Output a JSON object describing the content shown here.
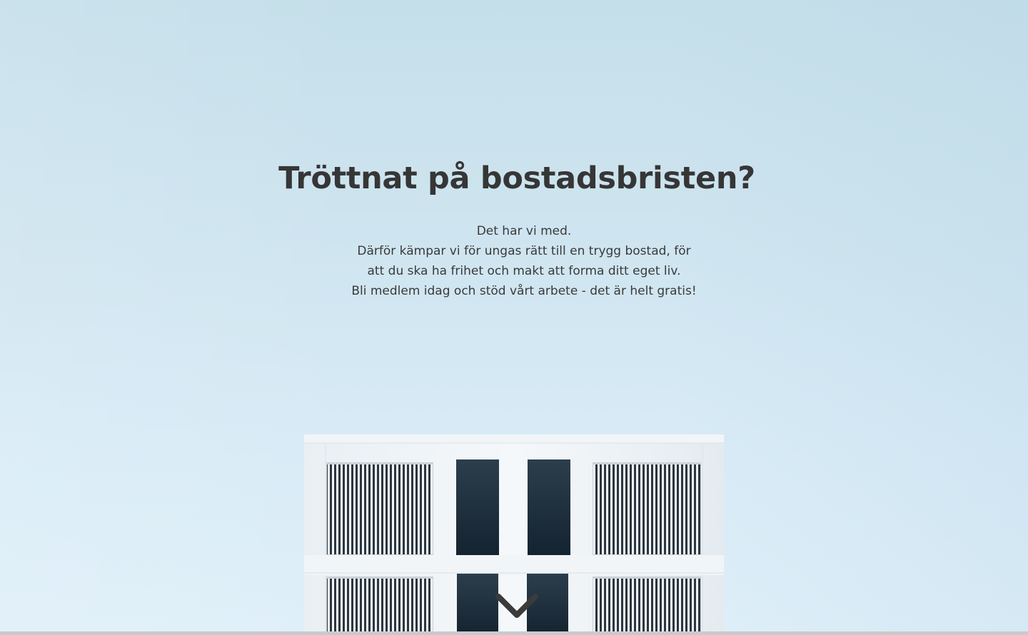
{
  "hero": {
    "headline": "Tröttnat på bostadsbristen?",
    "body_lines": [
      "Det har vi med.",
      "Därför kämpar vi för ungas rätt till en trygg bostad, för",
      "att du ska ha frihet och makt att forma ditt eget liv.",
      "Bli medlem idag och stöd vårt arbete - det är helt gratis!"
    ],
    "image": "building-facade-against-sky",
    "scroll_icon": "chevron-down-icon"
  },
  "colors": {
    "sky_top": "#c5dfea",
    "sky_bottom": "#dfeff9",
    "text": "#363636",
    "building": "#eef3f6",
    "windows": "#1f2f3b"
  }
}
